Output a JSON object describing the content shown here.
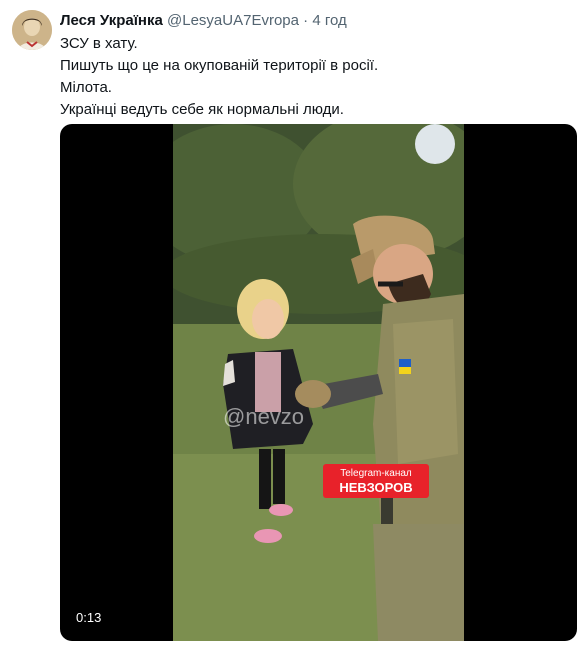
{
  "tweet": {
    "author_name": "Леся Українка",
    "author_handle": "@LesyaUA7Evropa",
    "separator": "·",
    "timestamp": "4 год",
    "text_lines": [
      "ЗСУ в хату.",
      "Пишуть що це на окупованій території в росії.",
      "Мілота.",
      "Українці ведуть себе як нормальні люди."
    ]
  },
  "video": {
    "duration": "0:13",
    "watermark": "@nevzo",
    "overlay_line1": "Telegram-канал",
    "overlay_line2": "НЕВЗОРОВ"
  },
  "colors": {
    "text": "#0f1419",
    "secondary": "#536471",
    "overlay_red": "#e8222a"
  }
}
